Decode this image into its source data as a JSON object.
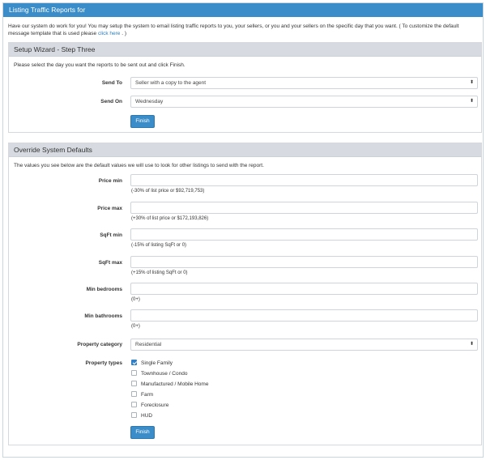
{
  "header": {
    "title": "Listing Traffic Reports for"
  },
  "intro": {
    "text": "Have our system do work for you! You may setup the system to email listing traffic reports to you, your sellers, or you and your sellers on the specific day that you want. ( To customize the default message template that is used please ",
    "link": "click here",
    "suffix": ". )"
  },
  "wizard": {
    "title": "Setup Wizard - Step Three",
    "description": "Please select the day you want the reports to be sent out and click Finish.",
    "send_to": {
      "label": "Send To",
      "value": "Seller with a copy to the agent"
    },
    "send_on": {
      "label": "Send On",
      "value": "Wednesday"
    },
    "finish": "Finish"
  },
  "override": {
    "title": "Override System Defaults",
    "description": "The values you see below are the default values we will use to look for other listings to send with the report.",
    "price_min": {
      "label": "Price min",
      "value": "",
      "help": "(-30% of list price or $92,719,753)"
    },
    "price_max": {
      "label": "Price max",
      "value": "",
      "help": "(+30% of list price or $172,193,826)"
    },
    "sqft_min": {
      "label": "SqFt min",
      "value": "",
      "help": "(-15% of listing SqFt or 0)"
    },
    "sqft_max": {
      "label": "SqFt max",
      "value": "",
      "help": "(+15% of listing SqFt or 0)"
    },
    "min_bedrooms": {
      "label": "Min bedrooms",
      "value": "",
      "help": "(0+)"
    },
    "min_bathrooms": {
      "label": "Min bathrooms",
      "value": "",
      "help": "(0+)"
    },
    "property_category": {
      "label": "Property category",
      "value": "Residential"
    },
    "property_types": {
      "label": "Property types",
      "options": [
        {
          "label": "Single Family",
          "checked": true
        },
        {
          "label": "Townhouse / Condo",
          "checked": false
        },
        {
          "label": "Manufactured / Mobile Home",
          "checked": false
        },
        {
          "label": "Farm",
          "checked": false
        },
        {
          "label": "Foreclosure",
          "checked": false
        },
        {
          "label": "HUD",
          "checked": false
        }
      ]
    },
    "finish": "Finish"
  },
  "icons": {
    "select_caret": "⬍"
  },
  "colors": {
    "header": "#3a8dc8",
    "button": "#3a8dc8",
    "link": "#2a7fc1",
    "panel_head": "#d7dbe1"
  }
}
